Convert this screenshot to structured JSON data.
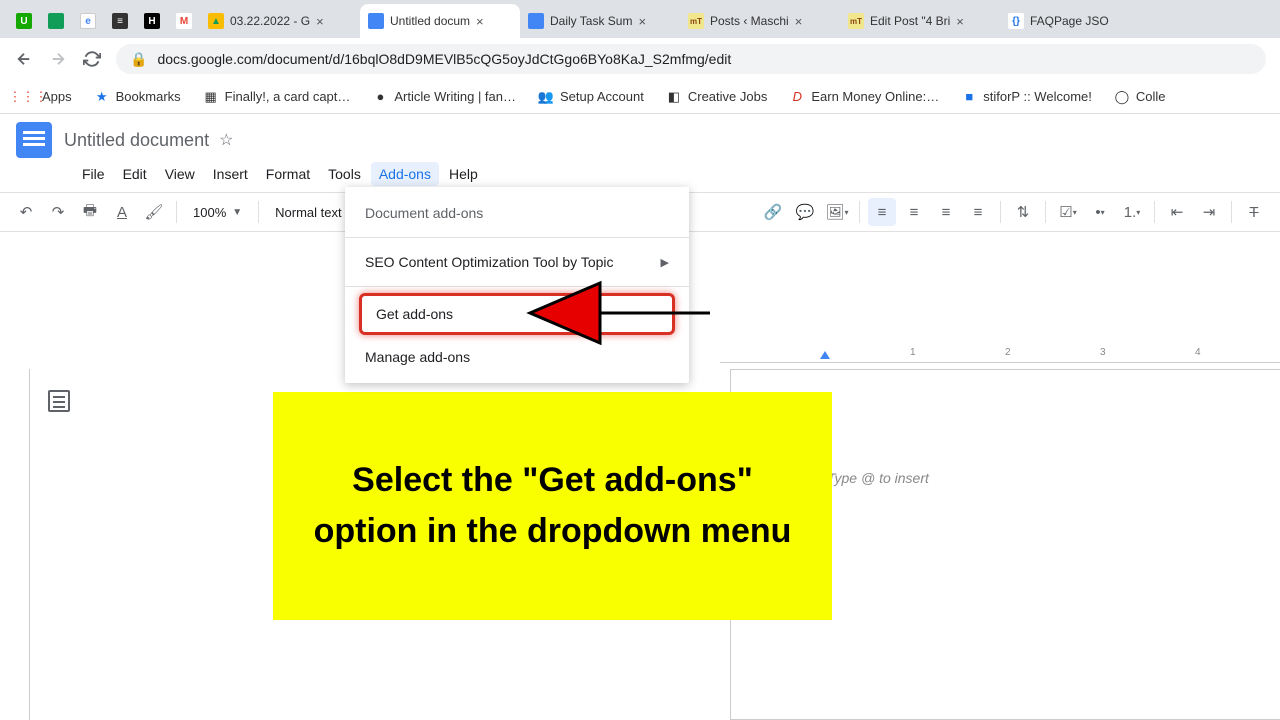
{
  "browser": {
    "tabs": [
      {
        "title": "",
        "favicon_bg": "#14a800",
        "favicon_text": "U"
      },
      {
        "title": "",
        "favicon_bg": "#0f9d58",
        "favicon_text": ""
      },
      {
        "title": "",
        "favicon_bg": "#4285f4",
        "favicon_text": "e"
      },
      {
        "title": "",
        "favicon_bg": "#333",
        "favicon_text": "≡"
      },
      {
        "title": "",
        "favicon_bg": "#000",
        "favicon_text": "H"
      },
      {
        "title": "",
        "favicon_bg": "#ea4335",
        "favicon_text": "M"
      },
      {
        "title": "03.22.2022 - G",
        "favicon_bg": "#fbbc04",
        "favicon_text": "▲",
        "close": true
      },
      {
        "title": "Untitled docum",
        "favicon_bg": "#4285f4",
        "favicon_text": "",
        "close": true,
        "active": true
      },
      {
        "title": "Daily Task Sum",
        "favicon_bg": "#4285f4",
        "favicon_text": "",
        "close": true
      },
      {
        "title": "Posts ‹ Maschi",
        "favicon_bg": "#8b4513",
        "favicon_text": "mT",
        "close": true
      },
      {
        "title": "Edit Post \"4 Bri",
        "favicon_bg": "#8b4513",
        "favicon_text": "mT",
        "close": true
      },
      {
        "title": "FAQPage JSO",
        "favicon_bg": "#1a73e8",
        "favicon_text": "{}"
      }
    ],
    "url": "docs.google.com/document/d/16bqlO8dD9MEVlB5cQG5oyJdCtGgo6BYo8KaJ_S2mfmg/edit"
  },
  "bookmarks": [
    {
      "icon": "⋮⋮⋮",
      "label": "Apps",
      "color": "#5f6368"
    },
    {
      "icon": "★",
      "label": "Bookmarks",
      "color": "#1a73e8"
    },
    {
      "icon": "▦",
      "label": "Finally!, a card capt…",
      "color": "#5f6368"
    },
    {
      "icon": "●",
      "label": "Article Writing | fan…",
      "color": "#333"
    },
    {
      "icon": "👥",
      "label": "Setup Account",
      "color": "#d93025"
    },
    {
      "icon": "◧",
      "label": "Creative Jobs",
      "color": "#333"
    },
    {
      "icon": "$",
      "label": "Earn Money Online:…",
      "color": "#d93025"
    },
    {
      "icon": "■",
      "label": "stiforP :: Welcome!",
      "color": "#1a73e8"
    },
    {
      "icon": "◯",
      "label": "Colle",
      "color": "#5f6368"
    }
  ],
  "docs": {
    "title": "Untitled document",
    "menus": [
      "File",
      "Edit",
      "View",
      "Insert",
      "Format",
      "Tools",
      "Add-ons",
      "Help"
    ],
    "active_menu": "Add-ons",
    "zoom": "100%",
    "style": "Normal text"
  },
  "dropdown": {
    "header": "Document add-ons",
    "items": [
      {
        "label": "SEO Content Optimization Tool by Topic",
        "has_submenu": true
      },
      {
        "label": "Get add-ons",
        "highlighted": true
      },
      {
        "label": "Manage add-ons"
      }
    ]
  },
  "page_placeholder": "Type @ to insert",
  "ruler_numbers": [
    "1",
    "2",
    "3",
    "4"
  ],
  "callout": "Select the \"Get add-ons\" option in the dropdown menu"
}
